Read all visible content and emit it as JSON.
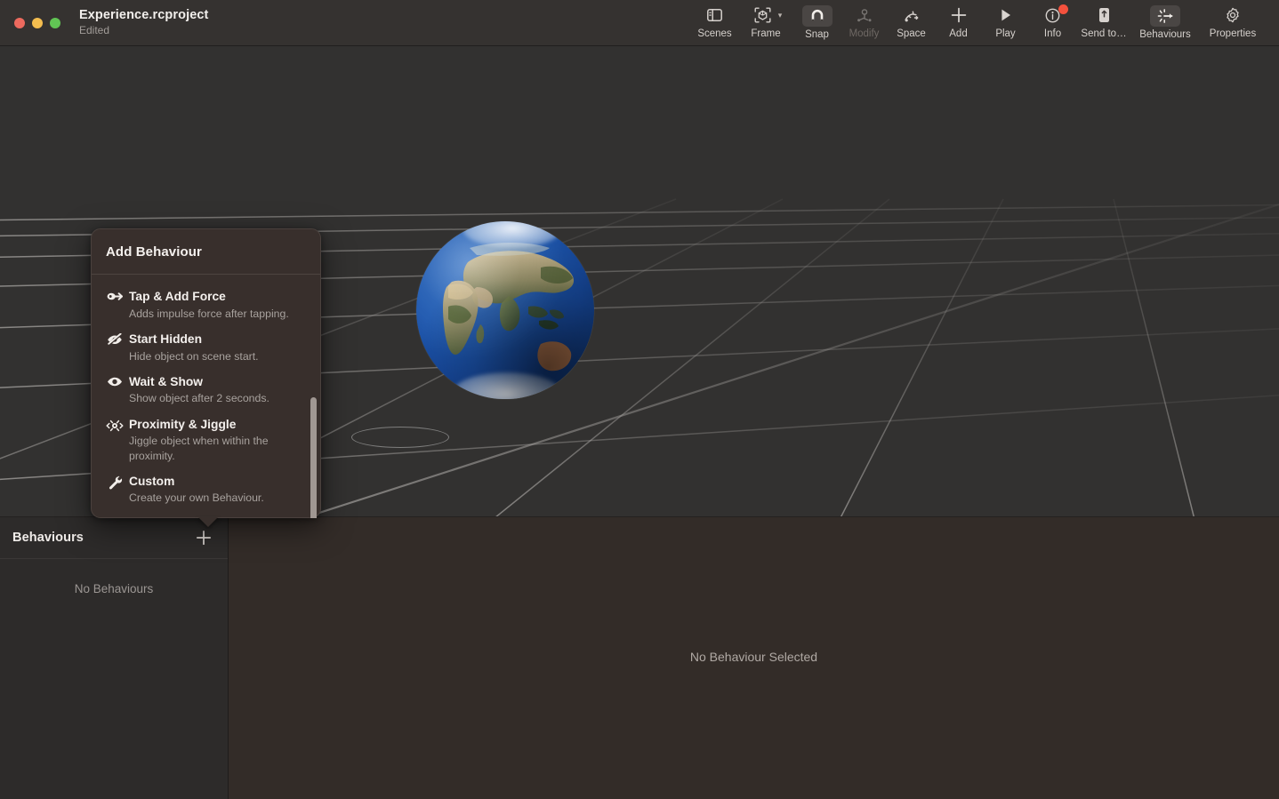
{
  "window": {
    "title": "Experience.rcproject",
    "subtitle": "Edited",
    "traffic_lights": [
      "close",
      "minimize",
      "maximize"
    ]
  },
  "toolbar": {
    "items": [
      {
        "label": "Scenes",
        "icon": "sidebar-icon",
        "active": false,
        "disabled": false,
        "badge": false,
        "chevron": false
      },
      {
        "label": "Frame",
        "icon": "frame-object-icon",
        "active": false,
        "disabled": false,
        "badge": false,
        "chevron": true
      },
      {
        "label": "Snap",
        "icon": "magnet-icon",
        "active": true,
        "disabled": false,
        "badge": false,
        "chevron": false
      },
      {
        "label": "Modify",
        "icon": "modify-icon",
        "active": false,
        "disabled": true,
        "badge": false,
        "chevron": false
      },
      {
        "label": "Space",
        "icon": "space-icon",
        "active": false,
        "disabled": false,
        "badge": false,
        "chevron": false
      },
      {
        "label": "Add",
        "icon": "plus-icon",
        "active": false,
        "disabled": false,
        "badge": false,
        "chevron": false
      },
      {
        "label": "Play",
        "icon": "play-icon",
        "active": false,
        "disabled": false,
        "badge": false,
        "chevron": false
      },
      {
        "label": "Info",
        "icon": "info-icon",
        "active": false,
        "disabled": false,
        "badge": true,
        "chevron": false
      },
      {
        "label": "Send to…",
        "icon": "send-to-icon",
        "active": false,
        "disabled": false,
        "badge": false,
        "chevron": false
      },
      {
        "label": "Behaviours",
        "icon": "behaviours-icon",
        "active": true,
        "disabled": false,
        "badge": false,
        "chevron": false
      },
      {
        "label": "Properties",
        "icon": "properties-icon",
        "active": false,
        "disabled": false,
        "badge": false,
        "chevron": false
      }
    ]
  },
  "viewport": {
    "object_name": "earth-globe",
    "grid": "perspective-floor-grid",
    "background_color": "#323130"
  },
  "behaviours_panel": {
    "header_title": "Behaviours",
    "add_button_label": "+",
    "empty_state": "No Behaviours",
    "detail_empty_state": "No Behaviour Selected"
  },
  "popover": {
    "title": "Add Behaviour",
    "items": [
      {
        "title": "Tap & Add Force",
        "desc": "Adds impulse force after tapping.",
        "icon": "tap-force-icon"
      },
      {
        "title": "Start Hidden",
        "desc": "Hide object on scene start.",
        "icon": "eye-slash-icon"
      },
      {
        "title": "Wait & Show",
        "desc": "Show object after 2 seconds.",
        "icon": "eye-icon"
      },
      {
        "title": "Proximity & Jiggle",
        "desc": "Jiggle object when within the proximity.",
        "icon": "proximity-icon"
      },
      {
        "title": "Custom",
        "desc": "Create your own Behaviour.",
        "icon": "wrench-icon"
      }
    ]
  },
  "colors": {
    "titlebar_bg": "#353230",
    "viewport_bg": "#323130",
    "panel_bg": "#332c28",
    "list_bg": "#2d2b2a",
    "popover_bg": "#382f2c",
    "accent_badge": "#f4513d",
    "globe_ocean": "#1f59b0"
  }
}
